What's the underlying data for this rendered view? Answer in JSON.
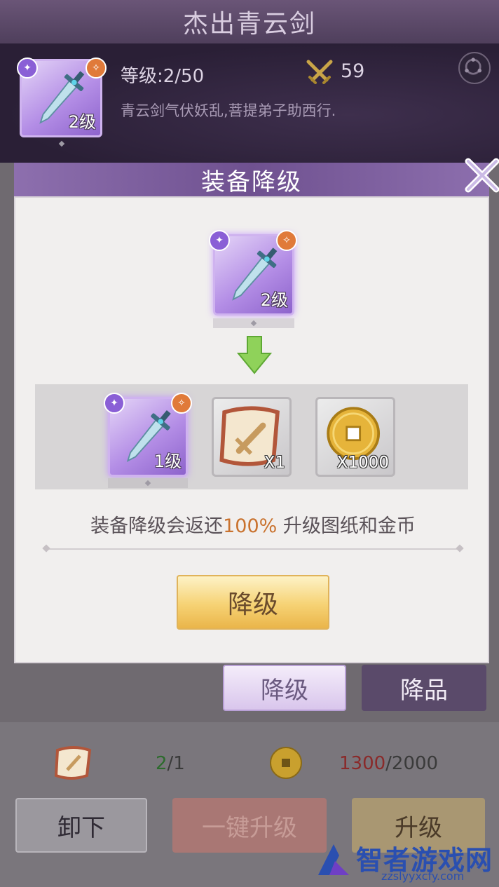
{
  "page": {
    "item_name": "杰出青云剑",
    "level_text": "等级:2/50",
    "power": "59",
    "description": "青云剑气伏妖乱,菩提弟子助西行.",
    "item_level_label": "2级"
  },
  "modal": {
    "title": "装备降级",
    "source_item": {
      "level_label": "2级"
    },
    "results": [
      {
        "type": "sword",
        "label": "1级"
      },
      {
        "type": "scroll",
        "label": "X1"
      },
      {
        "type": "coin",
        "label": "X1000"
      }
    ],
    "note_before": "装备降级会返还",
    "note_highlight": "100%",
    "note_after": " 升级图纸和金币",
    "confirm_label": "降级"
  },
  "tabs": {
    "downgrade_label": "降级",
    "quality_down_label": "降品"
  },
  "costs": {
    "scroll_have": "2",
    "scroll_need": "/1",
    "coin_have": "1300",
    "coin_need": "/2000"
  },
  "buttons": {
    "unequip_label": "卸下",
    "one_click_label": "一键升级",
    "upgrade_label": "升级"
  },
  "watermark": {
    "name": "智者游戏网",
    "url": "zzslyyxcfy.com"
  },
  "colors": {
    "accent_purple": "#8d6fae",
    "highlight_orange": "#c9722e",
    "confirm_gold": "#f6d274"
  }
}
